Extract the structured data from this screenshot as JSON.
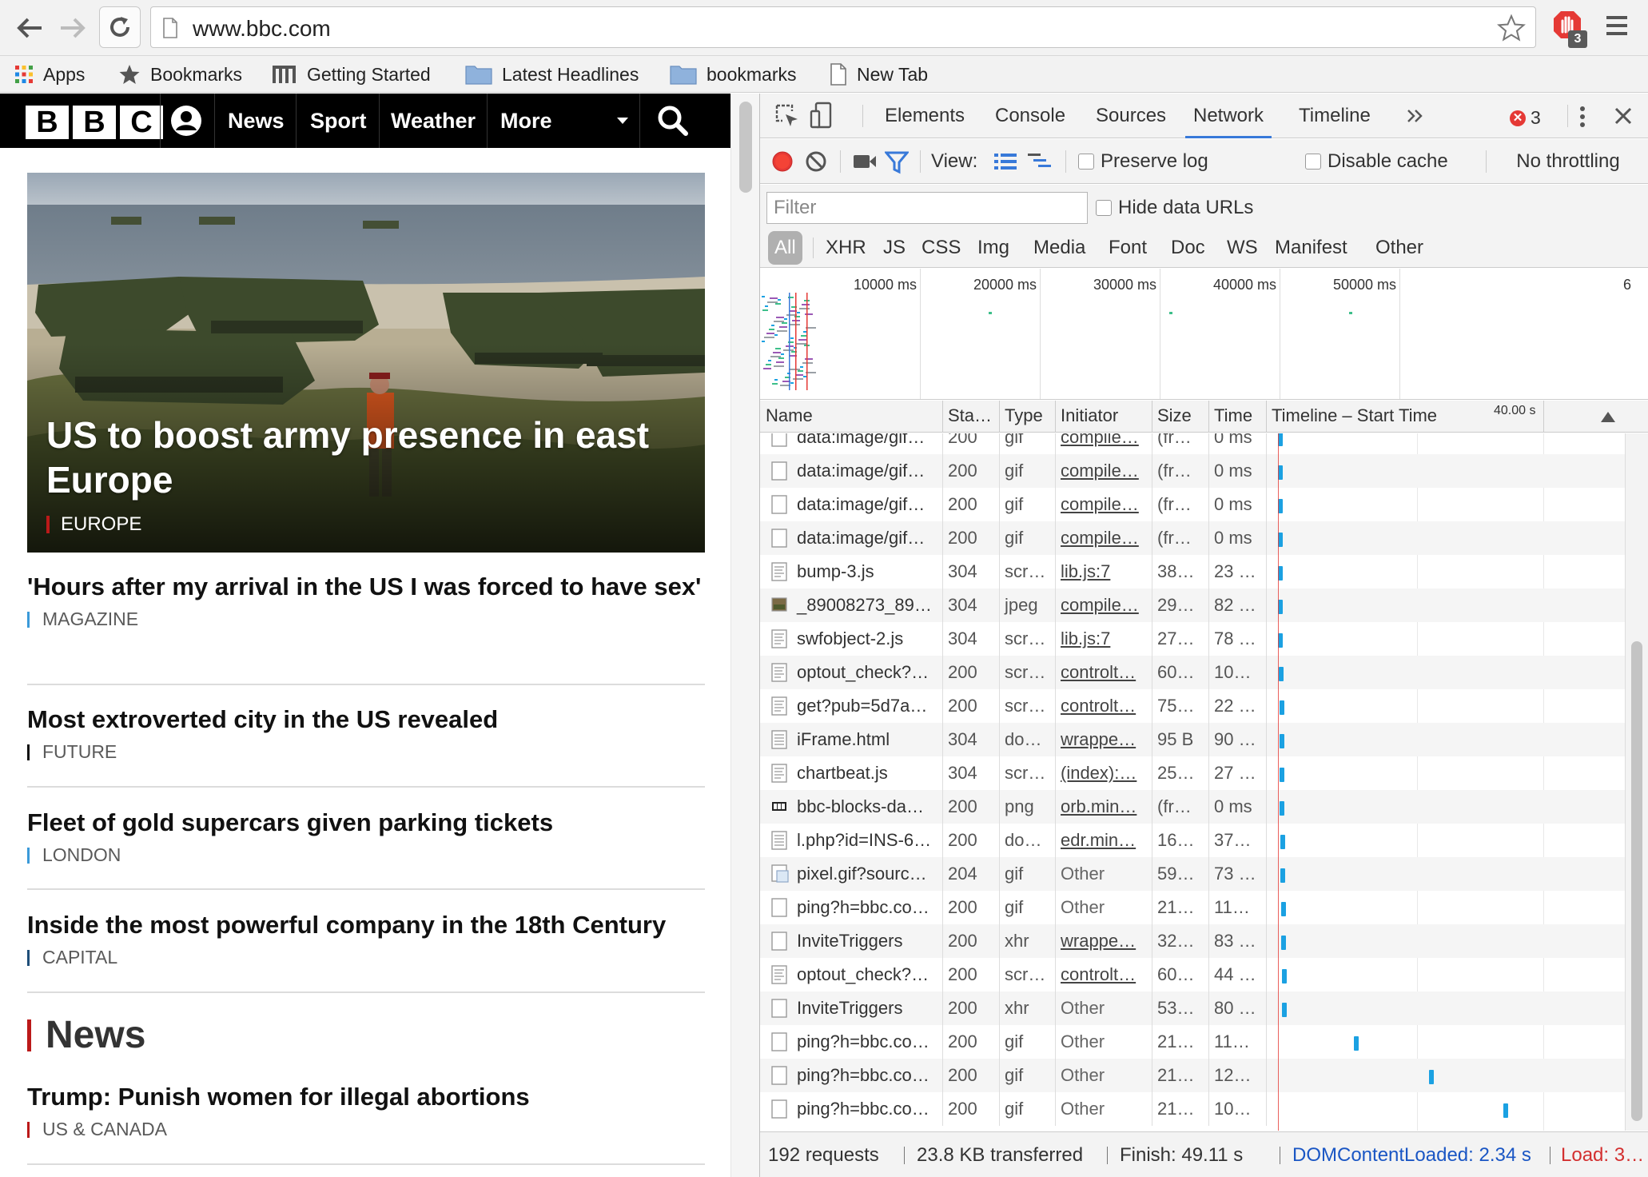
{
  "browser": {
    "url": "www.bbc.com",
    "extension_badge": "3",
    "bookmarks": [
      {
        "label": "Apps",
        "icon": "apps-grid-icon"
      },
      {
        "label": "Bookmarks",
        "icon": "star-icon"
      },
      {
        "label": "Getting Started",
        "icon": "m-logo-icon"
      },
      {
        "label": "Latest Headlines",
        "icon": "folder-icon"
      },
      {
        "label": "bookmarks",
        "icon": "folder-icon"
      },
      {
        "label": "New Tab",
        "icon": "page-icon"
      }
    ]
  },
  "bbc": {
    "logo_letters": [
      "B",
      "B",
      "C"
    ],
    "nav": [
      "News",
      "Sport",
      "Weather",
      "More"
    ],
    "hero": {
      "headline": "US to boost army presence in east Europe",
      "tag": "EUROPE",
      "tag_color": "#bb1919"
    },
    "stories": [
      {
        "headline": "'Hours after my arrival in the US I was forced to have sex'",
        "tag": "MAGAZINE",
        "tag_color": "#3b9ad9"
      },
      {
        "headline": "Most extroverted city in the US revealed",
        "tag": "FUTURE",
        "tag_color": "#111111"
      },
      {
        "headline": "Fleet of gold supercars given parking tickets",
        "tag": "LONDON",
        "tag_color": "#3b9ad9"
      },
      {
        "headline": "Inside the most powerful company in the 18th Century",
        "tag": "CAPITAL",
        "tag_color": "#1f4e79"
      }
    ],
    "section_title": "News",
    "news_story": {
      "headline": "Trump: Punish women for illegal abortions",
      "tag": "US & CANADA",
      "tag_color": "#bb1919"
    }
  },
  "devtools": {
    "tabs": [
      "Elements",
      "Console",
      "Sources",
      "Network",
      "Timeline"
    ],
    "active_tab": "Network",
    "error_count": "3",
    "controls": {
      "view_label": "View:",
      "preserve_log": "Preserve log",
      "disable_cache": "Disable cache",
      "throttling": "No throttling"
    },
    "filter_placeholder": "Filter",
    "hide_data_urls": "Hide data URLs",
    "filter_types": [
      "All",
      "XHR",
      "JS",
      "CSS",
      "Img",
      "Media",
      "Font",
      "Doc",
      "WS",
      "Manifest",
      "Other"
    ],
    "overview_labels": [
      "10000 ms",
      "20000 ms",
      "30000 ms",
      "40000 ms",
      "50000 ms",
      "6"
    ],
    "columns": [
      "Name",
      "Sta…",
      "Type",
      "Initiator",
      "Size",
      "Time",
      "Timeline – Start Time"
    ],
    "timeline_marker": "40.00 s",
    "requests": [
      {
        "name": "data:image/gif…",
        "status": "200",
        "type": "gif",
        "initiator": "compile…",
        "initiator_link": true,
        "size": "(fr…",
        "time": "0 ms",
        "icon": "blank",
        "bar_ms": 2340
      },
      {
        "name": "data:image/gif…",
        "status": "200",
        "type": "gif",
        "initiator": "compile…",
        "initiator_link": true,
        "size": "(fr…",
        "time": "0 ms",
        "icon": "blank",
        "bar_ms": 2340
      },
      {
        "name": "data:image/gif…",
        "status": "200",
        "type": "gif",
        "initiator": "compile…",
        "initiator_link": true,
        "size": "(fr…",
        "time": "0 ms",
        "icon": "blank",
        "bar_ms": 2340
      },
      {
        "name": "data:image/gif…",
        "status": "200",
        "type": "gif",
        "initiator": "compile…",
        "initiator_link": true,
        "size": "(fr…",
        "time": "0 ms",
        "icon": "blank",
        "bar_ms": 2340
      },
      {
        "name": "bump-3.js",
        "status": "304",
        "type": "scr…",
        "initiator": "lib.js:7",
        "initiator_link": true,
        "size": "38…",
        "time": "23 …",
        "icon": "script",
        "bar_ms": 2400
      },
      {
        "name": "_89008273_89…",
        "status": "304",
        "type": "jpeg",
        "initiator": "compile…",
        "initiator_link": true,
        "size": "29…",
        "time": "82 …",
        "icon": "image",
        "bar_ms": 2400
      },
      {
        "name": "swfobject-2.js",
        "status": "304",
        "type": "scr…",
        "initiator": "lib.js:7",
        "initiator_link": true,
        "size": "27…",
        "time": "78 …",
        "icon": "script",
        "bar_ms": 2400
      },
      {
        "name": "optout_check?…",
        "status": "200",
        "type": "scr…",
        "initiator": "controlt…",
        "initiator_link": true,
        "size": "60…",
        "time": "10…",
        "icon": "script",
        "bar_ms": 2600
      },
      {
        "name": "get?pub=5d7a…",
        "status": "200",
        "type": "scr…",
        "initiator": "controlt…",
        "initiator_link": true,
        "size": "75…",
        "time": "22 …",
        "icon": "script",
        "bar_ms": 2650
      },
      {
        "name": "iFrame.html",
        "status": "304",
        "type": "do…",
        "initiator": "wrappe…",
        "initiator_link": true,
        "size": "95 B",
        "time": "90 …",
        "icon": "doc",
        "bar_ms": 2700
      },
      {
        "name": "chartbeat.js",
        "status": "304",
        "type": "scr…",
        "initiator": "(index):…",
        "initiator_link": true,
        "size": "25…",
        "time": "27 …",
        "icon": "script",
        "bar_ms": 2750
      },
      {
        "name": "bbc-blocks-da…",
        "status": "200",
        "type": "png",
        "initiator": "orb.min…",
        "initiator_link": true,
        "size": "(fr…",
        "time": "0 ms",
        "icon": "logo",
        "bar_ms": 2800
      },
      {
        "name": "l.php?id=INS-6…",
        "status": "200",
        "type": "do…",
        "initiator": "edr.min…",
        "initiator_link": true,
        "size": "16…",
        "time": "37…",
        "icon": "doc",
        "bar_ms": 2900
      },
      {
        "name": "pixel.gif?sourc…",
        "status": "204",
        "type": "gif",
        "initiator": "Other",
        "initiator_link": false,
        "size": "59…",
        "time": "73 …",
        "icon": "pixel",
        "bar_ms": 2950
      },
      {
        "name": "ping?h=bbc.co…",
        "status": "200",
        "type": "gif",
        "initiator": "Other",
        "initiator_link": false,
        "size": "21…",
        "time": "11…",
        "icon": "blank",
        "bar_ms": 3000
      },
      {
        "name": "InviteTriggers",
        "status": "200",
        "type": "xhr",
        "initiator": "wrappe…",
        "initiator_link": true,
        "size": "32…",
        "time": "83 …",
        "icon": "blank",
        "bar_ms": 3100
      },
      {
        "name": "optout_check?…",
        "status": "200",
        "type": "scr…",
        "initiator": "controlt…",
        "initiator_link": true,
        "size": "60…",
        "time": "44 …",
        "icon": "script",
        "bar_ms": 3150
      },
      {
        "name": "InviteTriggers",
        "status": "200",
        "type": "xhr",
        "initiator": "Other",
        "initiator_link": false,
        "size": "53…",
        "time": "80 …",
        "icon": "blank",
        "bar_ms": 3200
      },
      {
        "name": "ping?h=bbc.co…",
        "status": "200",
        "type": "gif",
        "initiator": "Other",
        "initiator_link": false,
        "size": "21…",
        "time": "11…",
        "icon": "blank",
        "bar_ms": 17700
      },
      {
        "name": "ping?h=bbc.co…",
        "status": "200",
        "type": "gif",
        "initiator": "Other",
        "initiator_link": false,
        "size": "21…",
        "time": "12…",
        "icon": "blank",
        "bar_ms": 32700
      },
      {
        "name": "ping?h=bbc.co…",
        "status": "200",
        "type": "gif",
        "initiator": "Other",
        "initiator_link": false,
        "size": "21…",
        "time": "10…",
        "icon": "blank",
        "bar_ms": 47700
      }
    ],
    "status_bar": {
      "requests": "192 requests",
      "transferred": "23.8 KB transferred",
      "finish": "Finish: 49.11 s",
      "dom_content_loaded": "DOMContentLoaded: 2.34 s",
      "load": "Load: 3…",
      "dcl_color": "#1a56c4",
      "load_color": "#d32f2f"
    }
  }
}
